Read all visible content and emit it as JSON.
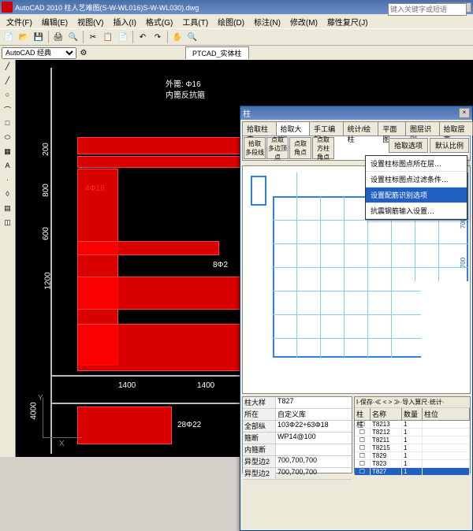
{
  "app": {
    "title": "AutoCAD 2010  柱人艺难图(S-W-WL016)S-W-WL030).dwg",
    "search_placeholder": "键入关键字或短语"
  },
  "menu": [
    "文件(F)",
    "编辑(E)",
    "视图(V)",
    "插入(I)",
    "格式(G)",
    "工具(T)",
    "绘图(D)",
    "标注(N)",
    "修改(M)",
    "藤性复尺(J)"
  ],
  "workspace": {
    "label": "AutoCAD 经典"
  },
  "tab": {
    "label": "PTCAD_实体柱"
  },
  "canvas": {
    "dims": [
      "200",
      "800",
      "600",
      "1200",
      "4000",
      "1400",
      "1400"
    ],
    "labels": {
      "outer": "外篦: Φ16",
      "inner": "内篦反抗箍",
      "r1": "4Φ18",
      "r2": "8Φ2",
      "r3": "28Φ22"
    }
  },
  "dialog": {
    "title": "柱",
    "tabs": [
      "拾取柱表",
      "拾取大样",
      "手工编辑",
      "统计/绘柱",
      "平面图",
      "图层识别",
      "拾取层高"
    ],
    "tools": [
      "拾取\n多段线",
      "点取\n多边顶点",
      "点取\n角点",
      "点取\n方柱\n角点"
    ],
    "opt1": "拾取选项",
    "opt2": "默认比例",
    "menu_items": [
      "设置柱标图点所在层…",
      "设置柱标图点过滤条件…",
      "设置配筋识别选项",
      "抗震钢筋输入设置…"
    ],
    "preview_dims": [
      "700",
      "700"
    ]
  },
  "props": {
    "hdr_l": "柱大样",
    "hdr_r": "T827",
    "rows": [
      {
        "l": "所在",
        "r": "自定义库"
      },
      {
        "l": "全部纵",
        "r": "103Φ22+63Φ18"
      },
      {
        "l": "箍断",
        "r": "WP14@100"
      },
      {
        "l": "内箍断",
        "r": ""
      },
      {
        "l": "异型边2",
        "r": "700,700,700"
      },
      {
        "l": "异型边2",
        "r": "700,700,700"
      }
    ]
  },
  "list": {
    "toolbar": "I·保存·≪ < > ≫·导入算尺·统计·",
    "cols": [
      "柱柱",
      "名称",
      "数量",
      "柱位"
    ],
    "rows": [
      {
        "n": "T8213",
        "q": "1"
      },
      {
        "n": "T8212",
        "q": "1"
      },
      {
        "n": "T8211",
        "q": "1"
      },
      {
        "n": "T8215",
        "q": "1"
      },
      {
        "n": "T829",
        "q": "1"
      },
      {
        "n": "T823",
        "q": "1"
      },
      {
        "n": "T827",
        "q": "1"
      }
    ]
  }
}
